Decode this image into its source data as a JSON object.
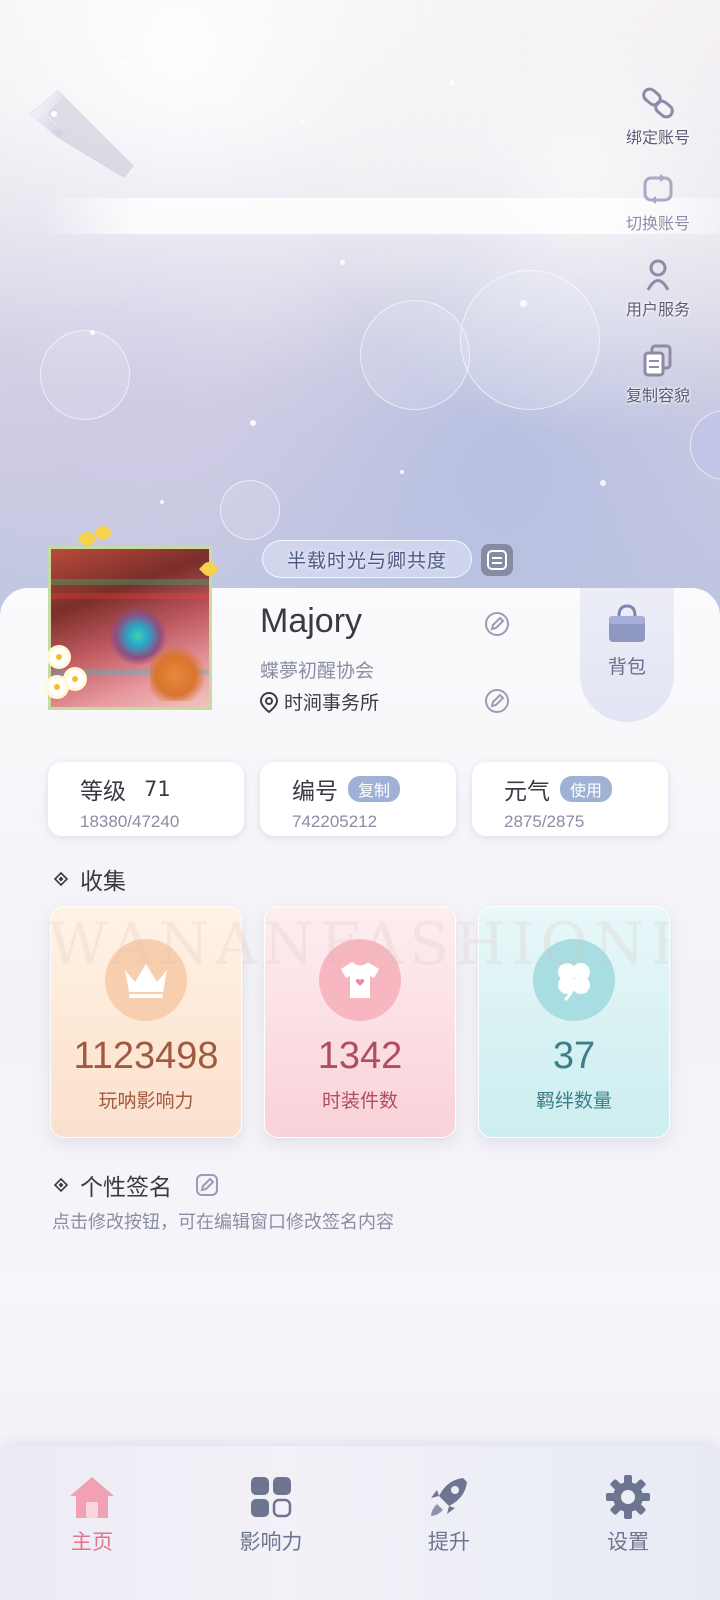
{
  "header": {
    "actions": [
      {
        "id": "bind",
        "label": "绑定账号",
        "icon": "link-icon"
      },
      {
        "id": "switch",
        "label": "切换账号",
        "icon": "switch-account-icon"
      },
      {
        "id": "service",
        "label": "用户服务",
        "icon": "user-service-icon"
      },
      {
        "id": "copy",
        "label": "复制容貌",
        "icon": "copy-icon"
      }
    ],
    "title_badge": "半载时光与卿共度"
  },
  "profile": {
    "name": "Majory",
    "guild": "蝶夢初醒协会",
    "location": "时涧事务所",
    "bag_label": "背包"
  },
  "stats": [
    {
      "title": "等级",
      "value": "71",
      "sub": "18380/47240",
      "tag": ""
    },
    {
      "title": "编号",
      "value": "",
      "sub": "742205212",
      "tag": "复制"
    },
    {
      "title": "元气",
      "value": "",
      "sub": "2875/2875",
      "tag": "使用"
    }
  ],
  "collection": {
    "title": "收集",
    "watermark": "WANANFASHIONBOND",
    "items": [
      {
        "value": "1123498",
        "label": "玩呐影响力",
        "icon": "crown-icon"
      },
      {
        "value": "1342",
        "label": "时装件数",
        "icon": "tshirt-icon"
      },
      {
        "value": "37",
        "label": "羁绊数量",
        "icon": "clover-icon"
      }
    ]
  },
  "signature": {
    "title": "个性签名",
    "hint": "点击修改按钮，可在编辑窗口修改签名内容"
  },
  "nav": [
    {
      "label": "主页",
      "icon": "home-icon",
      "active": true
    },
    {
      "label": "影响力",
      "icon": "grid-icon",
      "active": false
    },
    {
      "label": "提升",
      "icon": "rocket-icon",
      "active": false
    },
    {
      "label": "设置",
      "icon": "gear-icon",
      "active": false
    }
  ],
  "colors": {
    "nav_active": "#e0768e",
    "nav_inactive": "#6d7590",
    "tag_bg": "#9fb2d6"
  }
}
